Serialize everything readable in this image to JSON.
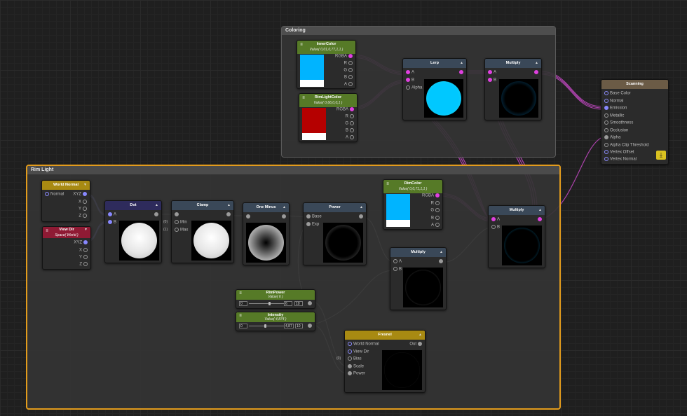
{
  "groups": {
    "coloring": "Coloring",
    "rim_light": "Rim Light"
  },
  "nodes": {
    "inner_color": {
      "title": "InnerColor",
      "value": "Value( 0,01,0,77,1,1 )",
      "ports": [
        "RGBA",
        "R",
        "G",
        "B",
        "A"
      ],
      "swatch": "#00b4ff"
    },
    "rim_light_color": {
      "title": "RimLightColor",
      "value": "Value( 0,66,0,0,1 )",
      "ports": [
        "RGBA",
        "R",
        "G",
        "B",
        "A"
      ],
      "swatch": "#b50000"
    },
    "lerp": {
      "title": "Lerp",
      "inputs": [
        "A",
        "B",
        "Alpha"
      ]
    },
    "multiply_top": {
      "title": "Multiply",
      "inputs": [
        "A",
        "B"
      ]
    },
    "scanning": {
      "title": "Scanning",
      "inputs": [
        "Base Color",
        "Normal",
        "Emission",
        "Metallic",
        "Smoothness",
        "Occlusion",
        "Alpha",
        "Alpha Clip Threshold",
        "Vertex Offset",
        "Vertex Normal"
      ]
    },
    "world_normal": {
      "title": "World Normal",
      "inputs": [
        "Normal"
      ],
      "outputs": [
        "XYZ",
        "X",
        "Y",
        "Z"
      ]
    },
    "view_dir": {
      "title": "View Dir",
      "sub": "Space( World )",
      "outputs": [
        "XYZ",
        "X",
        "Y",
        "Z"
      ]
    },
    "dot": {
      "title": "Dot",
      "inputs": [
        "A",
        "B"
      ]
    },
    "clamp": {
      "title": "Clamp",
      "inputs": [
        "Min",
        "Max"
      ],
      "tags": [
        "(0)",
        "(1)"
      ]
    },
    "one_minus": {
      "title": "One Minus"
    },
    "power": {
      "title": "Power",
      "inputs": [
        "Base",
        "Exp"
      ]
    },
    "rim_color": {
      "title": "RimColor",
      "value": "Value( 0,0,71,1,1 )",
      "ports": [
        "RGBA",
        "R",
        "G",
        "B",
        "A"
      ],
      "swatch": "#00b4ff"
    },
    "multiply_mid": {
      "title": "Multiply",
      "inputs": [
        "A",
        "B"
      ]
    },
    "multiply_rim": {
      "title": "Multiply",
      "inputs": [
        "A",
        "B"
      ]
    },
    "rim_power": {
      "title": "RimPower",
      "value": "Value( 6 )",
      "min": "0",
      "val": "6",
      "max": "10"
    },
    "intensity": {
      "title": "Intensity",
      "value": "Value( 4,874 )",
      "min": "0",
      "val": "4,87",
      "max": "10"
    },
    "fresnel": {
      "title": "Fresnel",
      "inputs": [
        "World Normal",
        "View Dir",
        "Bias",
        "Scale",
        "Power"
      ],
      "outputs": [
        "Out"
      ],
      "tag": "(0)"
    }
  },
  "icons": {
    "save": "save-download-icon",
    "property": "hamburger-icon",
    "collapse": "triangle-up-icon"
  },
  "colors": {
    "accent_group": "#e39c1c",
    "wire": "#c86ac8",
    "wire_gray": "#9a9a9a"
  }
}
